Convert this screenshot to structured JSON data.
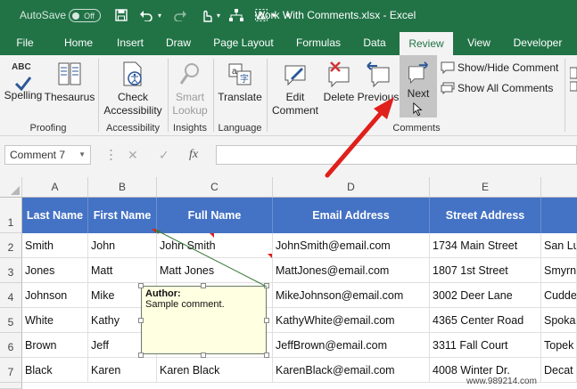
{
  "titlebar": {
    "autosave_label": "AutoSave",
    "autosave_state": "Off",
    "document_title": "Work With Comments.xlsx  -  Excel"
  },
  "tabs": [
    {
      "label": "File"
    },
    {
      "label": "Home"
    },
    {
      "label": "Insert"
    },
    {
      "label": "Draw"
    },
    {
      "label": "Page Layout"
    },
    {
      "label": "Formulas"
    },
    {
      "label": "Data"
    },
    {
      "label": "Review",
      "active": true
    },
    {
      "label": "View"
    },
    {
      "label": "Developer"
    }
  ],
  "ribbon": {
    "spelling": "Spelling",
    "thesaurus": "Thesaurus",
    "proofing_group": "Proofing",
    "check_accessibility_1": "Check",
    "check_accessibility_2": "Accessibility",
    "accessibility_group": "Accessibility",
    "smart_lookup_1": "Smart",
    "smart_lookup_2": "Lookup",
    "insights_group": "Insights",
    "translate": "Translate",
    "language_group": "Language",
    "edit_comment_1": "Edit",
    "edit_comment_2": "Comment",
    "delete": "Delete",
    "previous": "Previous",
    "next": "Next",
    "show_hide_comment": "Show/Hide Comment",
    "show_all_comments": "Show All Comments",
    "comments_group": "Comments",
    "spelling_icon_text": "ABC"
  },
  "formula_bar": {
    "name_box": "Comment 7",
    "fx_label": "fx",
    "content": ""
  },
  "grid": {
    "columns": [
      "A",
      "B",
      "C",
      "D",
      "E"
    ],
    "rows": [
      "1",
      "2",
      "3",
      "4",
      "5",
      "6",
      "7"
    ],
    "headers": [
      "Last Name",
      "First Name",
      "Full Name",
      "Email Address",
      "Street Address"
    ],
    "data": [
      [
        "Smith",
        "John",
        "John Smith",
        "JohnSmith@email.com",
        "1734 Main Street",
        "San Lu"
      ],
      [
        "Jones",
        "Matt",
        "Matt Jones",
        "MattJones@email.com",
        "1807 1st Street",
        "Smyrn"
      ],
      [
        "Johnson",
        "Mike",
        "",
        "MikeJohnson@email.com",
        "3002 Deer Lane",
        "Cudde"
      ],
      [
        "White",
        "Kathy",
        "",
        "KathyWhite@email.com",
        "4365 Center Road",
        "Spoka"
      ],
      [
        "Brown",
        "Jeff",
        "",
        "JeffBrown@email.com",
        "3311 Fall Court",
        "Topek"
      ],
      [
        "Black",
        "Karen",
        "Karen Black",
        "KarenBlack@email.com",
        "4008 Winter Dr.",
        "Decat"
      ]
    ]
  },
  "comment": {
    "author": "Author:",
    "text": "Sample comment."
  },
  "watermark": "www.989214.com",
  "colors": {
    "excel_green": "#217346",
    "header_blue": "#4472c4",
    "comment_yellow": "#ffffe1",
    "annotation_red": "#e0201b"
  }
}
